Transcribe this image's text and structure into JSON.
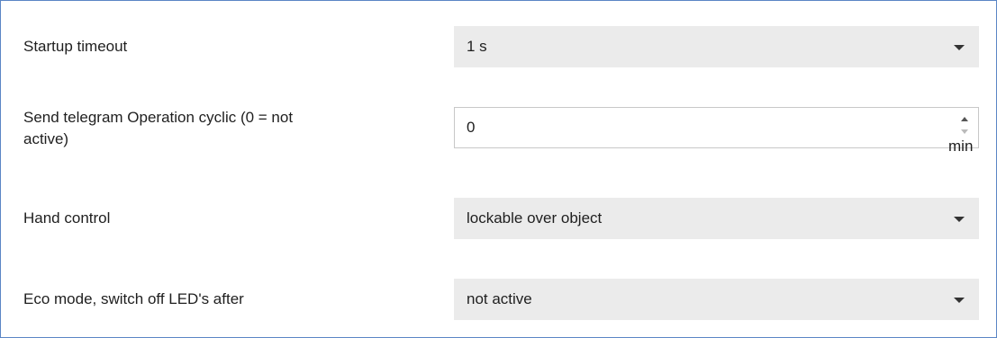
{
  "settings": [
    {
      "label": "Startup timeout",
      "type": "select",
      "value": "1 s"
    },
    {
      "label_line1": "Send telegram Operation cyclic  (0 = not",
      "label_line2": "active)",
      "type": "number",
      "value": "0",
      "unit": "min"
    },
    {
      "label": "Hand control",
      "type": "select",
      "value": "lockable over object"
    },
    {
      "label": "Eco mode, switch off LED's after",
      "type": "select",
      "value": "not active"
    }
  ],
  "icons": {
    "dropdown": "chevron-down-icon",
    "spin_up": "arrow-up-icon",
    "spin_down": "arrow-down-icon"
  },
  "colors": {
    "frame_border": "#5b86c5",
    "select_background": "#ebebeb",
    "input_border": "#c8c8c8"
  }
}
